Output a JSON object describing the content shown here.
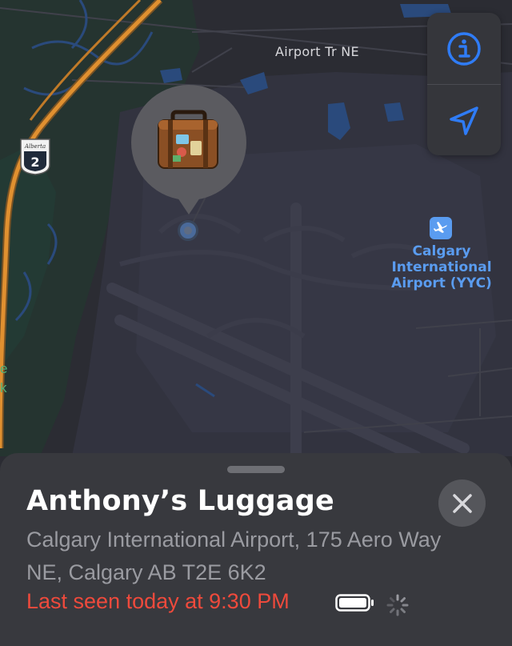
{
  "map": {
    "road_label": "Airport Tr NE",
    "highway_number": "2",
    "highway_province": "Alberta",
    "airport_label_lines": [
      "Calgary",
      "International",
      "Airport (YYC)"
    ],
    "edge_text_lines": [
      "e",
      "k"
    ],
    "item_pin_icon": "luggage-icon"
  },
  "controls": {
    "info_icon": "info-icon",
    "location_icon": "location-arrow-icon"
  },
  "sheet": {
    "title": "Anthony’s Luggage",
    "address": "Calgary International Airport, 175 Aero Way NE, Calgary AB T2E 6K2",
    "last_seen": "Last seen today at 9:30 PM",
    "battery_level": 1.0,
    "close_icon": "close-icon"
  },
  "colors": {
    "accent": "#2f7cf6",
    "airport_label": "#5a9cf0",
    "last_seen": "#ef4a3c",
    "highway": "#e09030"
  }
}
